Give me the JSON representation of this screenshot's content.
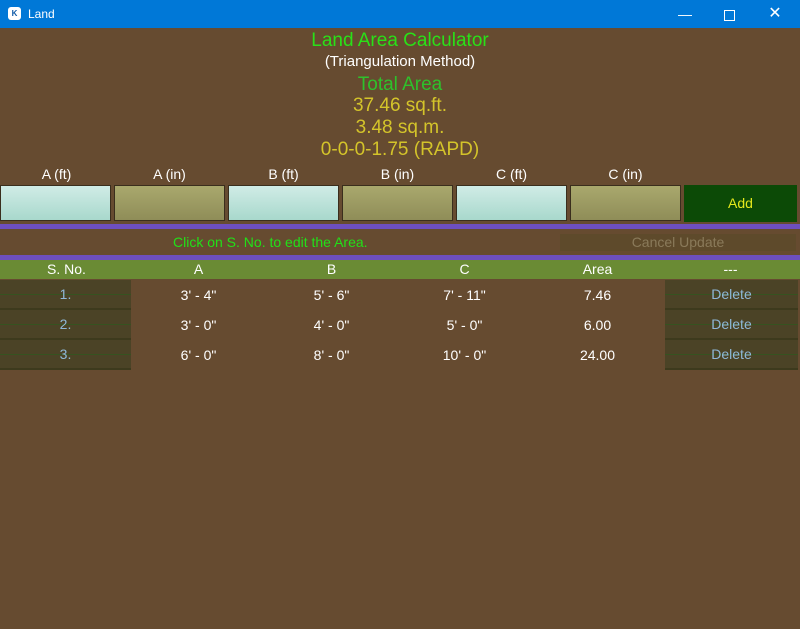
{
  "window": {
    "title": "Land",
    "app_icon": "kivy-app-icon",
    "minimize": "—",
    "maximize": "maximize-icon",
    "close": "✕"
  },
  "header": {
    "title": "Land Area Calculator",
    "subtitle": "(Triangulation Method)",
    "total_label": "Total Area",
    "total_sqft": "37.46 sq.ft.",
    "total_sqm": "3.48 sq.m.",
    "total_rapd": "0-0-0-1.75 (RAPD)"
  },
  "inputs": [
    {
      "label": "A (ft)",
      "value": ""
    },
    {
      "label": "A (in)",
      "value": ""
    },
    {
      "label": "B (ft)",
      "value": ""
    },
    {
      "label": "B (in)",
      "value": ""
    },
    {
      "label": "C (ft)",
      "value": ""
    },
    {
      "label": "C (in)",
      "value": ""
    }
  ],
  "add_label": "Add",
  "hint": "Click on S. No. to edit the Area.",
  "cancel_label": "Cancel Update",
  "table": {
    "headers": [
      "S. No.",
      "A",
      "B",
      "C",
      "Area",
      "---"
    ],
    "rows": [
      {
        "sno": "1.",
        "a": "3' - 4\"",
        "b": "5' - 6\"",
        "c": "7' - 11\"",
        "area": "7.46",
        "action": "Delete"
      },
      {
        "sno": "2.",
        "a": "3' - 0\"",
        "b": "4' - 0\"",
        "c": "5' - 0\"",
        "area": "6.00",
        "action": "Delete"
      },
      {
        "sno": "3.",
        "a": "6' - 0\"",
        "b": "8' - 0\"",
        "c": "10' - 0\"",
        "area": "24.00",
        "action": "Delete"
      }
    ]
  },
  "colors": {
    "background": "#664b30",
    "title_green": "#2ae018",
    "total_yellow": "#d4c42a",
    "header_green": "#6a8b34",
    "separator_purple": "#6d4fbf",
    "add_button": "#0c4a06"
  }
}
